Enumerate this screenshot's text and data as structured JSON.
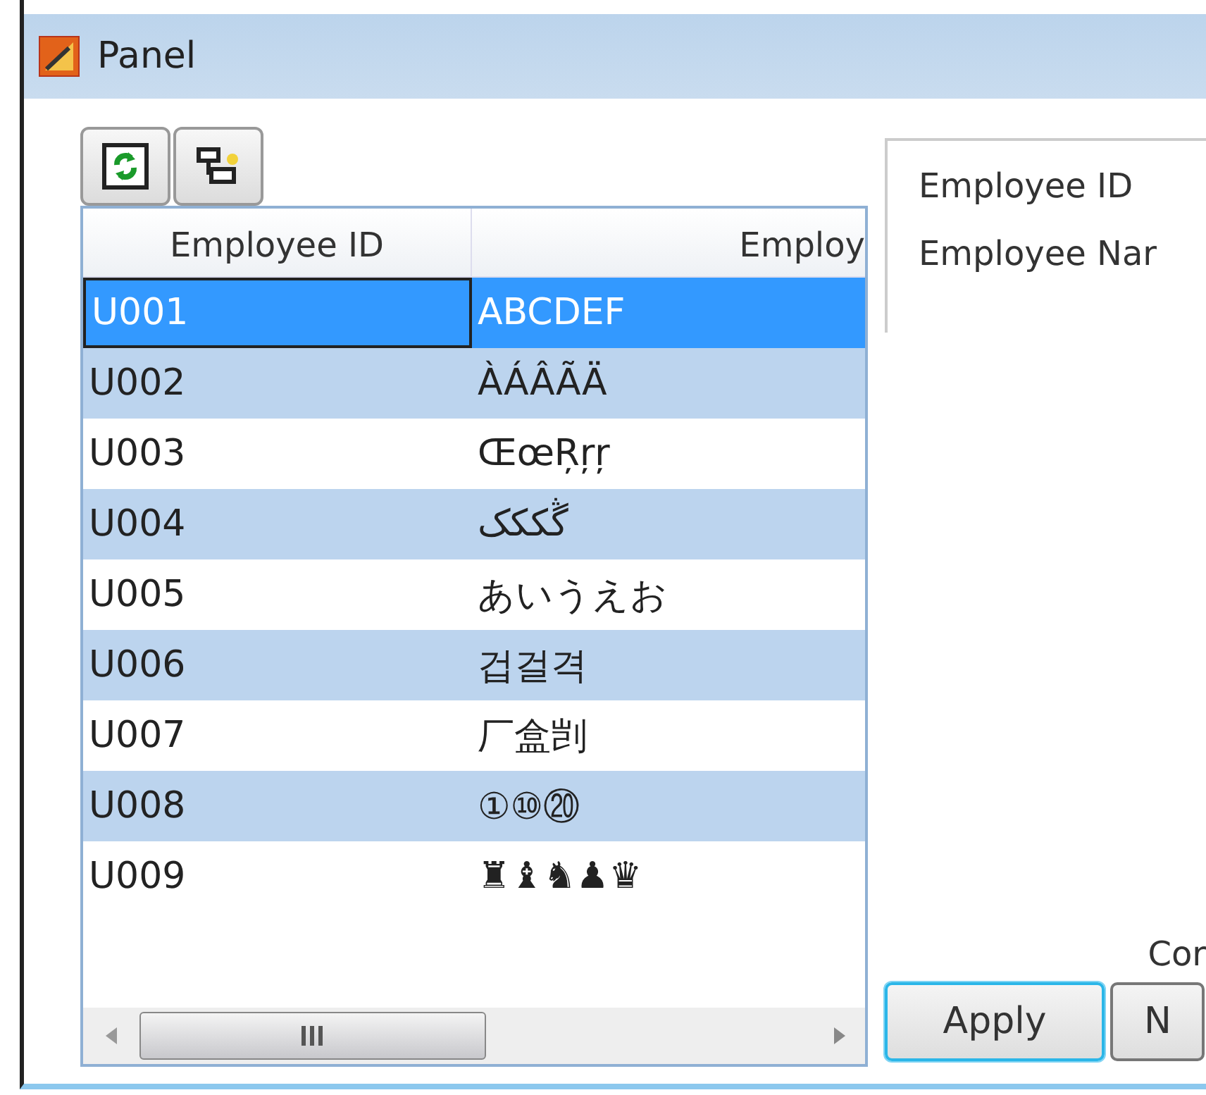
{
  "window": {
    "title": "Panel"
  },
  "toolbar": {
    "buttons": [
      {
        "kind": "refresh"
      },
      {
        "kind": "layout"
      }
    ]
  },
  "table": {
    "columns": [
      "Employee ID",
      "Employ"
    ],
    "rows": [
      {
        "id": "U001",
        "name": "ABCDEF",
        "selected": true
      },
      {
        "id": "U002",
        "name": "ÀÁÂÃÄ",
        "selected": false
      },
      {
        "id": "U003",
        "name": "ŒœŖŗŗ",
        "selected": false
      },
      {
        "id": "U004",
        "name": "ڴککک",
        "selected": false
      },
      {
        "id": "U005",
        "name": "あいうえお",
        "selected": false
      },
      {
        "id": "U006",
        "name": "겁걸격",
        "selected": false
      },
      {
        "id": "U007",
        "name": "厂盒剀",
        "selected": false
      },
      {
        "id": "U008",
        "name": "①⑩⑳",
        "selected": false
      },
      {
        "id": "U009",
        "name": "♜♝♞♟♛",
        "selected": false
      }
    ]
  },
  "details": {
    "fields": [
      "Employee ID",
      "Employee Nar"
    ]
  },
  "footer_label": "Cor",
  "buttons": [
    {
      "label": "Apply",
      "focused": true
    },
    {
      "label": "N",
      "focused": false
    }
  ]
}
